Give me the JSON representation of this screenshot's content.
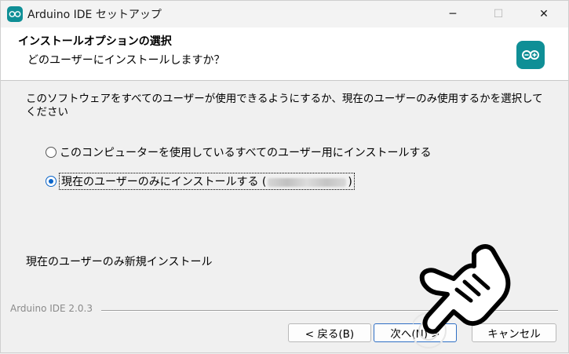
{
  "window": {
    "title": "Arduino IDE セットアップ",
    "controls": {
      "minimize": "─",
      "maximize": "☐",
      "close": "✕"
    }
  },
  "header": {
    "title": "インストールオプションの選択",
    "subtitle": "どのユーザーにインストールしますか？",
    "icon": "arduino-logo-icon"
  },
  "body": {
    "description": "このソフトウェアをすべてのユーザーが使用できるようにするか、現在のユーザーのみ使用するかを選択してください",
    "options": [
      {
        "label": "このコンピューターを使用しているすべてのユーザー用にインストールする",
        "selected": false
      },
      {
        "label_prefix": "現在のユーザーのみにインストールする (",
        "label_suffix": ")",
        "selected": true
      }
    ],
    "info": "現在のユーザーのみ新規インストール"
  },
  "footer": {
    "branding": "Arduino IDE 2.0.3",
    "buttons": {
      "back": "< 戻る(B)",
      "next": "次へ(N) >",
      "cancel": "キャンセル"
    }
  },
  "colors": {
    "accent": "#0f8f96",
    "radio_selected": "#0a64c8"
  }
}
